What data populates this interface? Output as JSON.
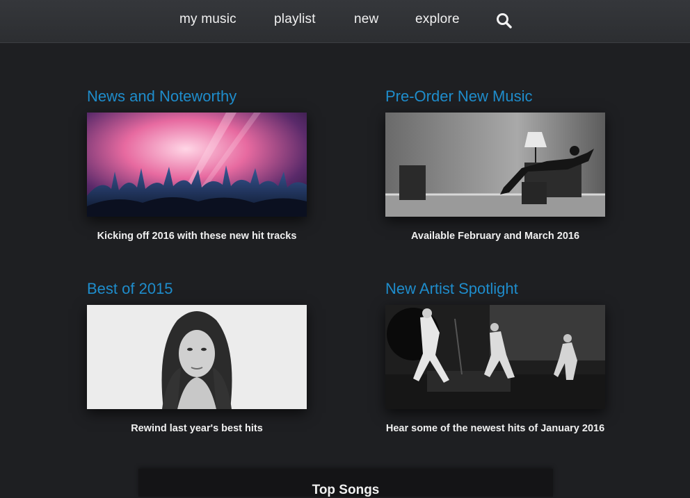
{
  "nav": {
    "items": [
      {
        "label": "my music"
      },
      {
        "label": "playlist"
      },
      {
        "label": "new"
      },
      {
        "label": "explore"
      }
    ],
    "search_icon": "search-icon"
  },
  "cards": [
    {
      "title": "News and Noteworthy",
      "caption": "Kicking off 2016 with these new hit tracks",
      "image": "concert-crowd-image"
    },
    {
      "title": "Pre-Order New Music",
      "caption": "Available February and March 2016",
      "image": "listener-in-armchair-image"
    },
    {
      "title": "Best of 2015",
      "caption": "Rewind last year's best hits",
      "image": "artist-portrait-image"
    },
    {
      "title": "New Artist Spotlight",
      "caption": "Hear some of the newest hits of January 2016",
      "image": "band-on-stage-image"
    }
  ],
  "top_songs": {
    "title": "Top Songs"
  },
  "colors": {
    "accent": "#1f8dcc",
    "background": "#1e1f22",
    "nav_background": "#2f3134"
  }
}
